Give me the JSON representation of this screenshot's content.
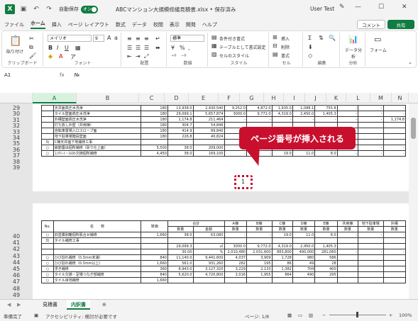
{
  "titlebar": {
    "autosave_label": "自動保存",
    "autosave_state": "オン",
    "filename": "ABCマンション大規模修繕見積書.xlsx • 保存済み",
    "user": "User Test"
  },
  "tabs": [
    "ファイル",
    "ホーム",
    "挿入",
    "ページ レイアウト",
    "数式",
    "データ",
    "校閲",
    "表示",
    "開発",
    "ヘルプ"
  ],
  "active_tab": "ホーム",
  "buttons": {
    "comment": "コメント",
    "share": "共有"
  },
  "ribbon": {
    "paste": "貼り付け",
    "clipboard": "クリップボード",
    "font_name": "メイリオ",
    "font_size": "9",
    "font_group": "フォント",
    "align_group": "配置",
    "number_format": "標準",
    "number_group": "数値",
    "cond_format": "条件付き書式",
    "table_format": "テーブルとして書式設定",
    "cell_style": "セルのスタイル",
    "style_group": "スタイル",
    "insert": "挿入",
    "delete": "削除",
    "format": "書式",
    "cell_group": "セル",
    "edit_group": "編集",
    "data_analysis": "データ分析",
    "analysis_group": "分析",
    "form": "フォーム"
  },
  "formula_bar": {
    "cell": "A1",
    "fx": "fx",
    "content": "№"
  },
  "columns": [
    "A",
    "B",
    "C",
    "D",
    "E",
    "F",
    "G",
    "H",
    "I",
    "J",
    "K",
    "L",
    "M",
    "N"
  ],
  "rows_top": [
    "29",
    "30",
    "31",
    "32",
    "33",
    "34",
    "35",
    "36",
    "37",
    "38",
    "39"
  ],
  "rows_bottom": [
    "40",
    "41",
    "42",
    "43",
    "44",
    "45",
    "46",
    "47",
    "48",
    "49"
  ],
  "top_table": [
    [
      "",
      "天井面高圧水洗浄",
      "180",
      "13,938.0",
      "2,430,540",
      "9,252.0",
      "4,872.0",
      "1,935.0",
      "1,088.1",
      "755.8",
      "-",
      "-",
      "-"
    ],
    [
      "",
      "タイル壁面高圧水洗浄",
      "180",
      "29,099.1",
      "5,657,874",
      "3000.0",
      "9,772.0",
      "4,319.0",
      "2,450.0",
      "1,405.3",
      "-",
      "-",
      "-"
    ],
    [
      "",
      "外構壁面高圧水洗浄",
      "180",
      "1,174.8",
      "211,464",
      "-",
      "-",
      "-",
      "-",
      "-",
      "-",
      "-",
      "1,174.8"
    ],
    [
      "",
      "打ち放し外壁（共用棟）",
      "180",
      "304.7",
      "54,846",
      "",
      "",
      "",
      "",
      "",
      "",
      "",
      ""
    ],
    [
      "",
      "自転車置場入口スロープ面",
      "180",
      "414.9",
      "89,840",
      "",
      "",
      "",
      "",
      "",
      "",
      "",
      ""
    ],
    [
      "",
      "地下駐車場階段壁面",
      "180",
      "226.8",
      "40,824",
      "",
      "",
      "",
      "",
      "",
      "",
      "",
      ""
    ],
    [
      "3)",
      "C棟天井面下地補修工事",
      "",
      "",
      "",
      "",
      "",
      "",
      "",
      "",
      "",
      "",
      ""
    ],
    [
      "○",
      "鉄筋露出個所補修（斫り仕上面）",
      "5,500",
      "38.0",
      "209,000",
      "-",
      "-",
      "19.0",
      "11.0",
      "8.0",
      "-",
      "-",
      "-"
    ],
    [
      "○",
      "ｺﾝｸﾘｰﾄ・ﾓﾙﾀﾙ欠損個所補修",
      "4,450",
      "38.0",
      "169,100",
      "-",
      "-",
      "19.0",
      "11.0",
      "8.0",
      "-",
      "-",
      "-"
    ]
  ],
  "page_number": "1",
  "callout": "ページ番号が挿入される",
  "bottom_headers": {
    "no": "No.",
    "name": "名　　称",
    "unit_price": "単価",
    "total": "合計",
    "a": "A棟",
    "b": "B棟",
    "c": "C棟",
    "d": "D棟",
    "e": "E棟",
    "common": "共用棟",
    "parking": "地下駐車場",
    "exterior": "外構",
    "qty": "数量",
    "amount": "金額"
  },
  "bottom_table": [
    [
      "○",
      "旧塗膜剥離個所肌合せ補修",
      "1,660",
      "38.0",
      "63,080",
      "-",
      "-",
      "19.0",
      "11.0",
      "8.0",
      "-",
      "-",
      "-"
    ],
    [
      "3)",
      "タイル補修工事",
      "",
      "",
      "",
      "",
      "",
      "",
      "",
      "",
      "",
      "",
      ""
    ],
    [
      "",
      "",
      "",
      "29,099.3",
      "㎡",
      "3000.0",
      "9,772.0",
      "4,319.0",
      "2,450.0",
      "1,405.3",
      "",
      "",
      ""
    ],
    [
      "",
      "",
      "",
      "30.00",
      "%",
      "2,010,480",
      "2,031,600",
      "863,800",
      "490,000",
      "281,060",
      "-",
      "-",
      "-"
    ],
    [
      "○",
      "ひび割れ補修（0.3mm未満）",
      "840",
      "11,140.0",
      "9,441,600",
      "4,037",
      "3,909",
      "1,728",
      "980",
      "586",
      "",
      "",
      ""
    ],
    [
      "○",
      "ひび割れ補修（0.3mm以上）",
      "1,660",
      "561.0",
      "931,260",
      "282",
      "195",
      "86",
      "49",
      "28",
      "",
      "",
      ""
    ],
    [
      "○",
      "浮き補修",
      "360",
      "8,943.0",
      "3,127,320",
      "3,229",
      "2,133",
      "1,382",
      "704",
      "400",
      "",
      "",
      ""
    ],
    [
      "○",
      "タイル欠損・足場つなぎ部補修",
      "840",
      "5,620.0",
      "4,720,800",
      "2,016",
      "1,955",
      "864",
      "490",
      "295",
      "",
      "",
      ""
    ],
    [
      "○",
      "タイル目地補修",
      "1,660",
      "",
      "",
      "",
      "",
      "",
      "",
      "",
      "",
      "",
      ""
    ]
  ],
  "sheet_tabs": [
    "見積書",
    "内訳書"
  ],
  "active_sheet": "内訳書",
  "status": {
    "ready": "準備完了",
    "accessibility": "アクセシビリティ: 検討が必要です",
    "page": "ページ: 1/8",
    "zoom": "100%"
  }
}
